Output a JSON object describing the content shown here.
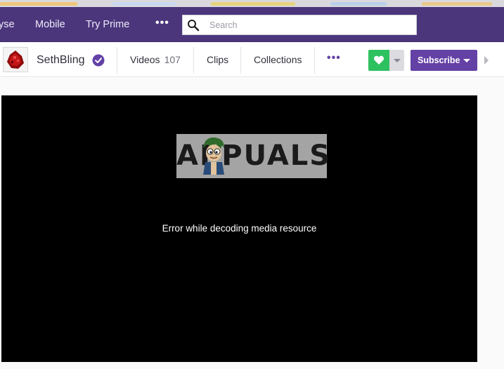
{
  "topnav": {
    "items": [
      {
        "label": "yse"
      },
      {
        "label": "Mobile"
      },
      {
        "label": "Try Prime"
      }
    ],
    "more_label": "•••",
    "search": {
      "placeholder": "Search",
      "value": ""
    }
  },
  "channel": {
    "name": "SethBling",
    "tabs": [
      {
        "label": "Videos",
        "count": "107"
      },
      {
        "label": "Clips"
      },
      {
        "label": "Collections"
      }
    ],
    "more_label": "•••",
    "subscribe_label": "Subscribe"
  },
  "player": {
    "watermark_text": "APPUALS",
    "error_message": "Error while decoding media resource"
  },
  "colors": {
    "nav_bg": "#4b367c",
    "brand_purple": "#6441a5",
    "follow_green": "#2ec160"
  }
}
